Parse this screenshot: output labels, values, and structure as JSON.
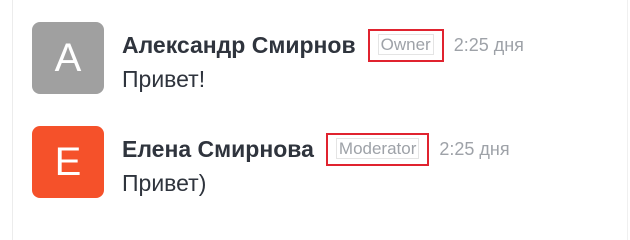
{
  "messages": [
    {
      "avatar_letter": "A",
      "avatar_color": "#a0a0a0",
      "author": "Александр Смирнов",
      "role": "Owner",
      "time": "2:25 дня",
      "text": "Привет!"
    },
    {
      "avatar_letter": "E",
      "avatar_color": "#f5512a",
      "author": "Елена Смирнова",
      "role": "Moderator",
      "time": "2:25 дня",
      "text": "Привет)"
    }
  ],
  "colors": {
    "badge_border": "#e0232f",
    "meta_text": "#9ea2a8",
    "author_text": "#2f343d"
  }
}
